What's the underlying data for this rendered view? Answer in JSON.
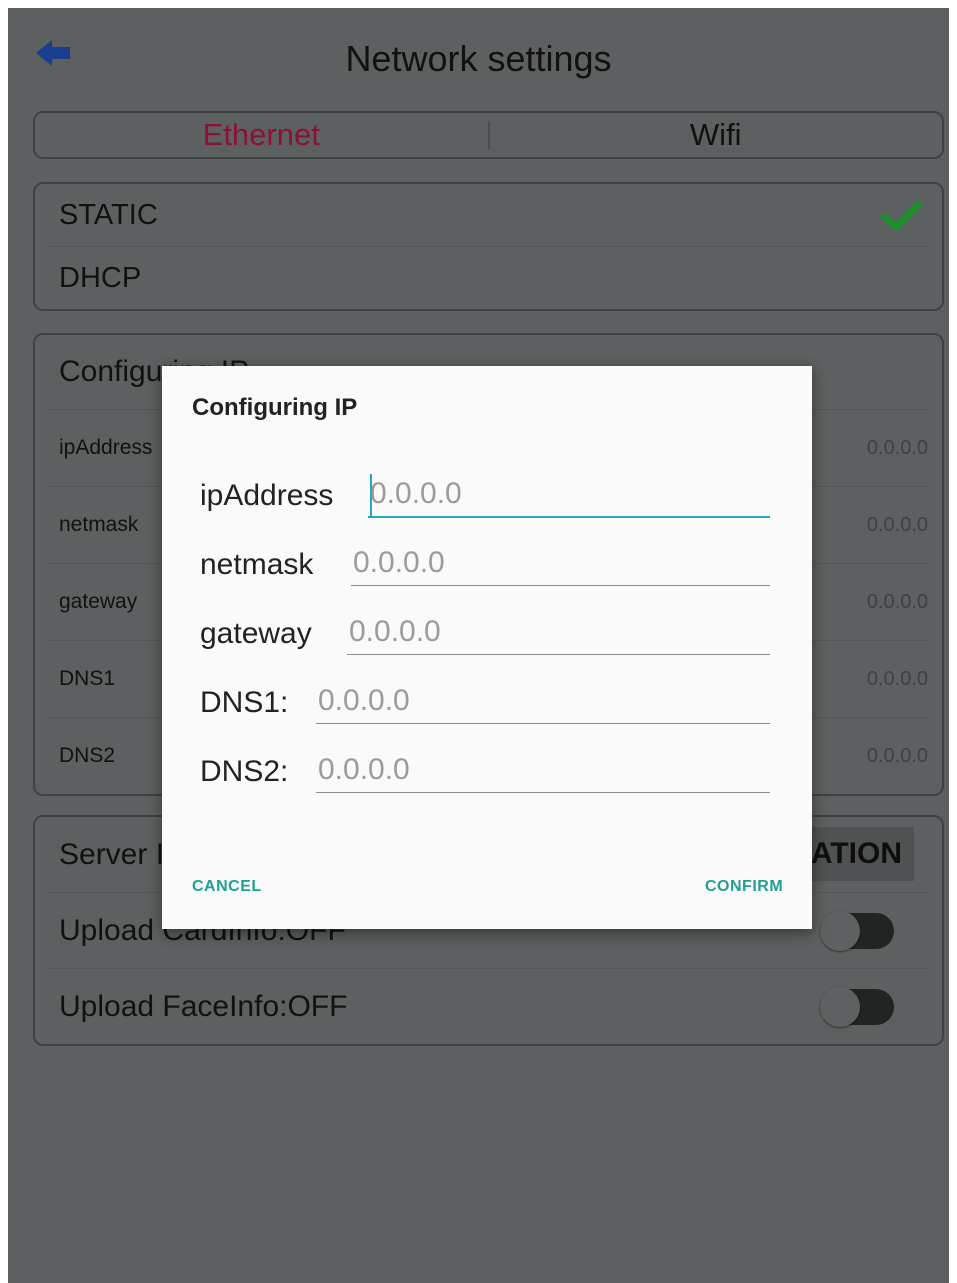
{
  "header": {
    "title": "Network settings",
    "back_icon": "arrow-left-icon"
  },
  "tabs": [
    {
      "label": "Ethernet",
      "active": true
    },
    {
      "label": "Wifi",
      "active": false
    }
  ],
  "ip_mode": {
    "options": [
      {
        "label": "STATIC",
        "selected": true
      },
      {
        "label": "DHCP",
        "selected": false
      }
    ]
  },
  "config": {
    "header": "Configuring IP",
    "rows": [
      {
        "label": "ipAddress",
        "value": "0.0.0.0"
      },
      {
        "label": "netmask",
        "value": "0.0.0.0"
      },
      {
        "label": "gateway",
        "value": "0.0.0.0"
      },
      {
        "label": "DNS1",
        "value": "0.0.0.0"
      },
      {
        "label": "DNS2",
        "value": "0.0.0.0"
      }
    ]
  },
  "server": {
    "row_label": "Server I",
    "button_label": "ATION",
    "upload_card": {
      "label": "Upload CardInfo:OFF",
      "on": false
    },
    "upload_face": {
      "label": "Upload FaceInfo:OFF",
      "on": false
    }
  },
  "dialog": {
    "title": "Configuring IP",
    "fields": [
      {
        "label": "ipAddress",
        "placeholder": "0.0.0.0",
        "focused": true
      },
      {
        "label": "netmask",
        "placeholder": "0.0.0.0",
        "focused": false
      },
      {
        "label": "gateway",
        "placeholder": "0.0.0.0",
        "focused": false
      },
      {
        "label": "DNS1:",
        "placeholder": "0.0.0.0",
        "focused": false
      },
      {
        "label": "DNS2:",
        "placeholder": "0.0.0.0",
        "focused": false
      }
    ],
    "cancel_label": "CANCEL",
    "confirm_label": "CONFIRM"
  },
  "colors": {
    "accent": "#27a7c0",
    "button_text": "#20a095",
    "active_tab": "#8a1238",
    "check": "#1f8f2e",
    "back_arrow": "#1a3d8f"
  }
}
